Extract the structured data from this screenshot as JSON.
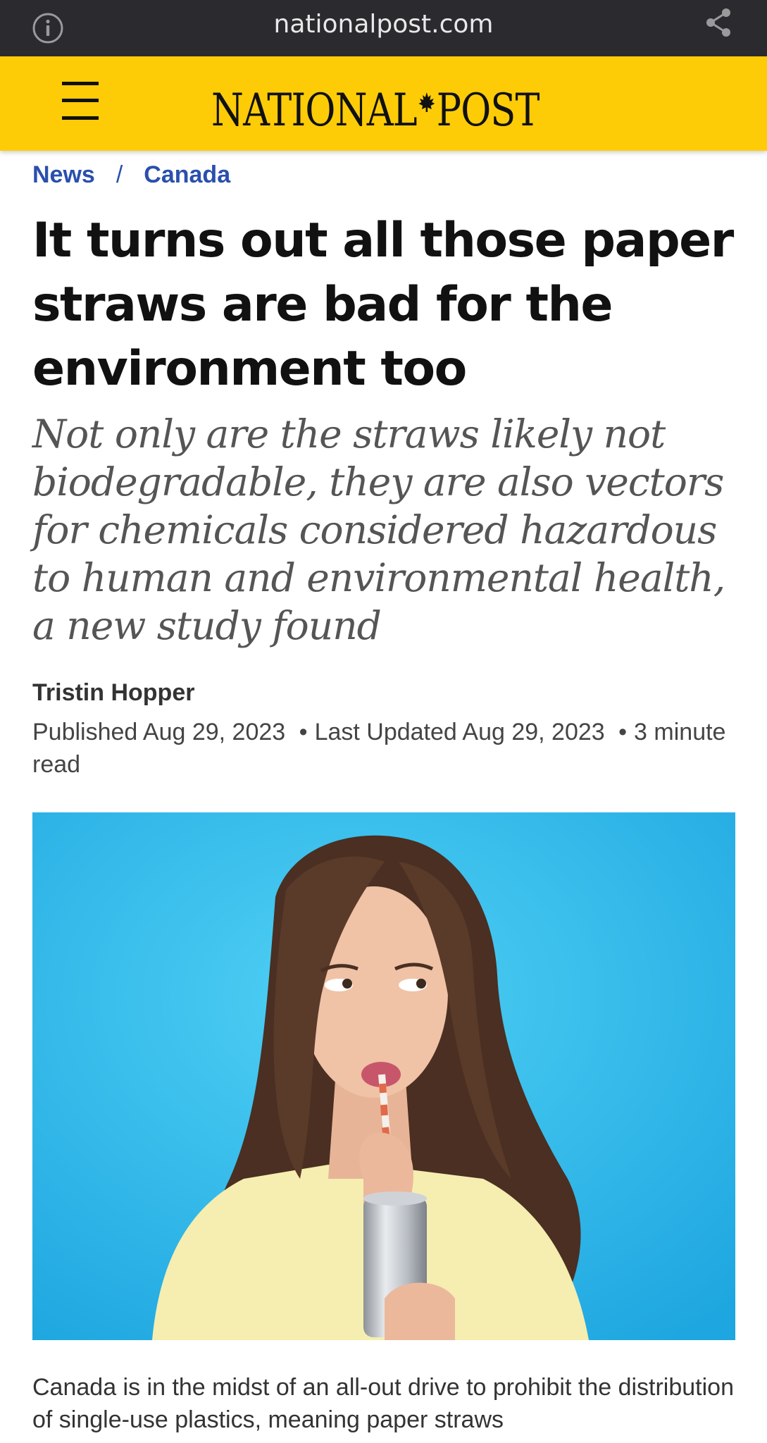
{
  "browser": {
    "url": "nationalpost.com",
    "info_icon": "info-icon",
    "share_icon": "share-icon"
  },
  "header": {
    "menu_icon": "hamburger-menu-icon",
    "logo_left": "NATIONAL",
    "logo_right": "POST",
    "brand_color": "#fecc07"
  },
  "breadcrumb": {
    "items": [
      "News",
      "Canada"
    ],
    "separator": "/"
  },
  "article": {
    "headline": "It turns out all those paper straws are bad for the environment too",
    "dek": "Not only are the straws likely not biodegradable, they are also vectors for chemicals considered hazardous to human and environmental health, a new study found",
    "author": "Tristin Hopper",
    "published": "Published Aug 29, 2023",
    "updated": "Last Updated Aug 29, 2023",
    "read_time": "3 minute read",
    "body_first": "Canada is in the midst of an all-out drive to prohibit the distribution of single-use plastics, meaning paper straws"
  },
  "colors": {
    "link": "#2a4fad",
    "photo_background": "#3ec0ec"
  }
}
